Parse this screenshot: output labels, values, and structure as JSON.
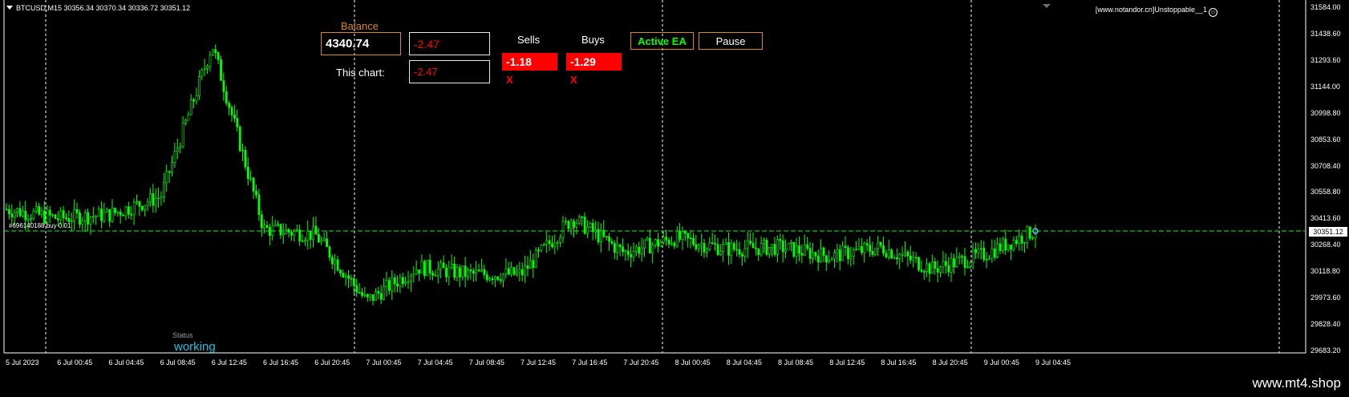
{
  "header": {
    "symbol_info": "BTCUSD,M15  30356.34 30370.34 30336.72 30351.12"
  },
  "top_right": {
    "text": "[www.notandor.cn]Unstoppable__1"
  },
  "panel": {
    "balance_label": "Balance",
    "balance_value": "4340.74",
    "total_profit": "-2.47",
    "this_chart_label": "This chart:",
    "this_chart_value": "-2.47",
    "sells_label": "Sells",
    "buys_label": "Buys",
    "sells_value": "-1.18",
    "buys_value": "-1.29",
    "close_sells": "X",
    "close_buys": "X",
    "active_ea_label": "Active EA",
    "pause_label": "Pause"
  },
  "status": {
    "label": "Status",
    "value": "working"
  },
  "order_label": "#696140188 buy 0.01",
  "current_price_tag": "30351.12",
  "y_axis_labels": [
    "31584.00",
    "31438.60",
    "31293.60",
    "31144.00",
    "30998.80",
    "30853.60",
    "30708.40",
    "30558.80",
    "30413.60",
    "30268.40",
    "30118.80",
    "29973.60",
    "29828.40",
    "29683.20"
  ],
  "x_axis_labels": [
    "5 Jul 2023",
    "6 Jul 00:45",
    "6 Jul 04:45",
    "6 Jul 08:45",
    "6 Jul 12:45",
    "6 Jul 16:45",
    "6 Jul 20:45",
    "7 Jul 00:45",
    "7 Jul 04:45",
    "7 Jul 08:45",
    "7 Jul 12:45",
    "7 Jul 16:45",
    "7 Jul 20:45",
    "8 Jul 00:45",
    "8 Jul 04:45",
    "8 Jul 08:45",
    "8 Jul 12:45",
    "8 Jul 16:45",
    "8 Jul 20:45",
    "9 Jul 00:45",
    "9 Jul 04:45"
  ],
  "footer": {
    "site": "www.mt4.shop"
  },
  "colors": {
    "candle": "#00ff00",
    "grid": "#ffffff",
    "price_line": "#00ff00",
    "ea_active": "#00ff00",
    "loss": "#ff0000",
    "status": "#19c3e0",
    "accent_border": "#d88a1e"
  },
  "chart_data": {
    "type": "line",
    "title": "BTCUSD,M15",
    "ylim": [
      29683.2,
      31584.0
    ],
    "x": [
      "5 Jul 2023",
      "6 Jul 00:45",
      "6 Jul 04:45",
      "6 Jul 08:45",
      "6 Jul 12:45",
      "6 Jul 16:45",
      "6 Jul 20:45",
      "7 Jul 00:45",
      "7 Jul 04:45",
      "7 Jul 08:45",
      "7 Jul 12:45",
      "7 Jul 16:45",
      "7 Jul 20:45",
      "8 Jul 00:45",
      "8 Jul 04:45",
      "8 Jul 08:45",
      "8 Jul 12:45",
      "8 Jul 16:45",
      "8 Jul 20:45",
      "9 Jul 00:45",
      "9 Jul 04:45"
    ],
    "series": [
      {
        "values": [
          30470,
          30420,
          30440,
          30540,
          31380,
          30360,
          30330,
          29960,
          30150,
          30110,
          30110,
          30420,
          30230,
          30310,
          30250,
          30260,
          30210,
          30260,
          30140,
          30220,
          30351.12
        ]
      }
    ]
  }
}
